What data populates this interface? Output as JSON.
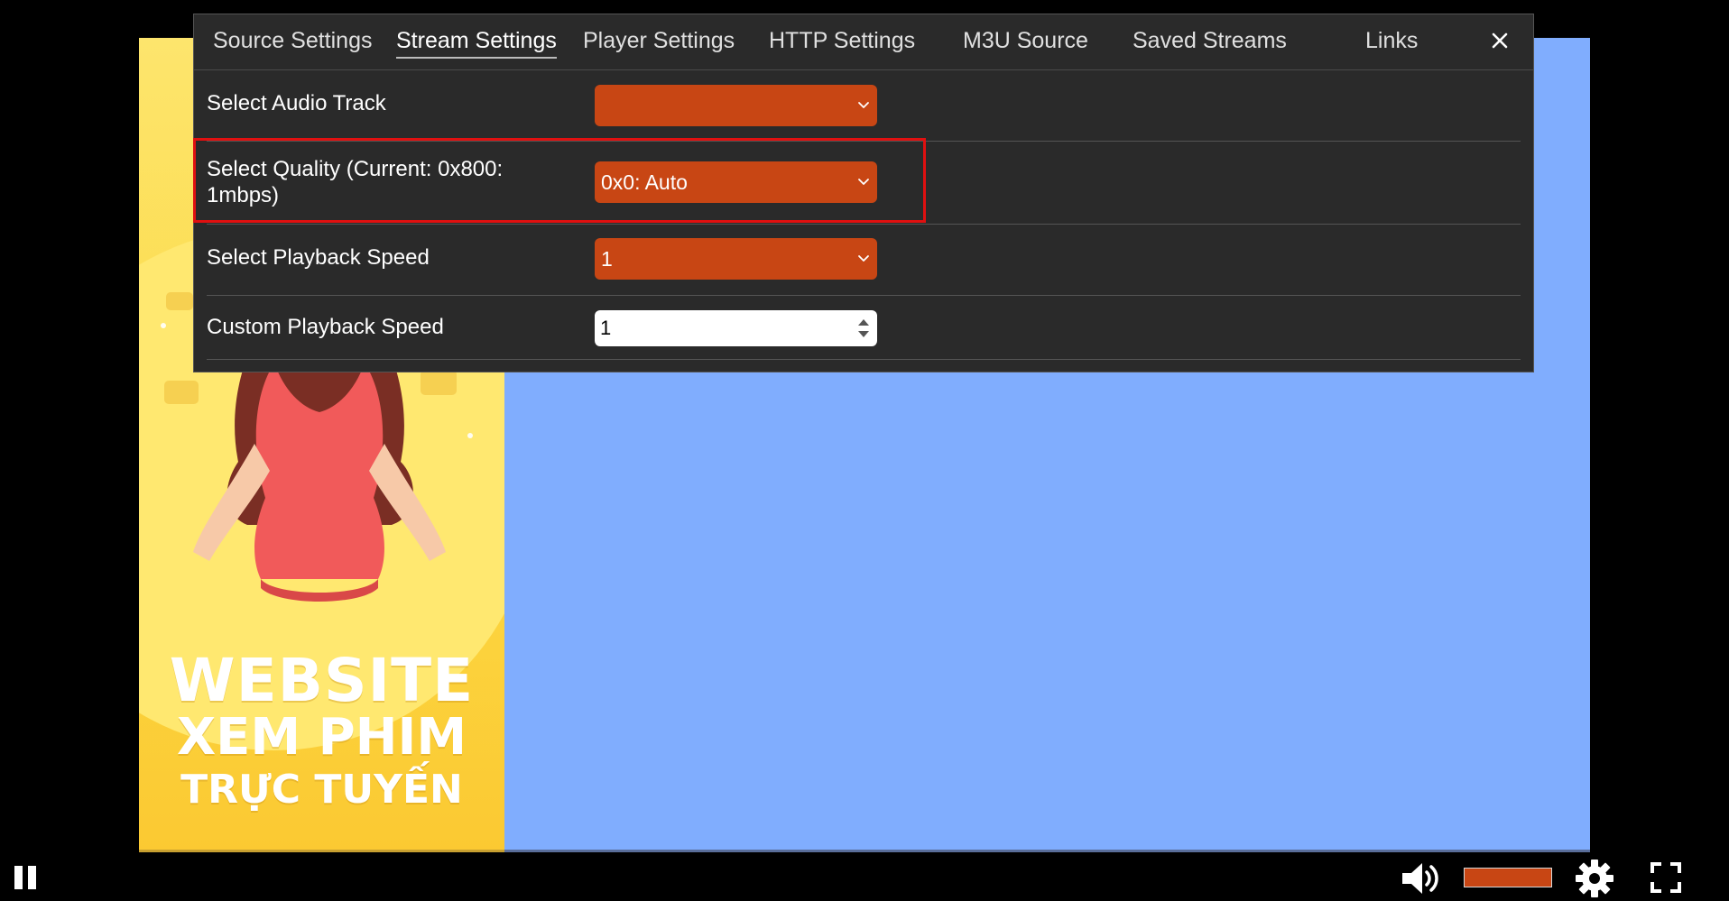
{
  "settings_dialog": {
    "tabs": [
      {
        "label": "Source Settings",
        "active": false
      },
      {
        "label": "Stream Settings",
        "active": true
      },
      {
        "label": "Player Settings",
        "active": false
      },
      {
        "label": "HTTP Settings",
        "active": false
      },
      {
        "label": "M3U Source",
        "active": false
      },
      {
        "label": "Saved Streams",
        "active": false
      },
      {
        "label": "Links",
        "active": false
      }
    ],
    "close_icon": "close-icon",
    "rows": {
      "audio_track": {
        "label": "Select Audio Track",
        "value": ""
      },
      "quality": {
        "label": "Select Quality (Current: 0x800: 1mbps)",
        "value": "0x0: Auto"
      },
      "playback_speed": {
        "label": "Select Playback Speed",
        "value": "1"
      },
      "custom_speed": {
        "label": "Custom Playback Speed",
        "value": "1"
      }
    }
  },
  "video": {
    "poster_text": {
      "line1": "WEBSITE",
      "line2": "XEM PHIM",
      "line3": "TRỰC TUYẾN"
    }
  },
  "controls": {
    "pause_icon": "pause-icon",
    "volume_icon": "volume-icon",
    "settings_icon": "gear-icon",
    "fullscreen_icon": "fullscreen-icon"
  },
  "colors": {
    "accent": "#c84614",
    "dialog_bg": "#2a2a2a",
    "video_bg": "#80adfe",
    "highlight": "#e01010"
  }
}
